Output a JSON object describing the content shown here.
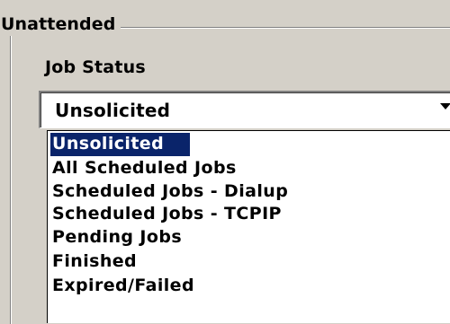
{
  "group": {
    "title": "Unattended"
  },
  "job_status": {
    "label": "Job Status",
    "selected_value": "Unsolicited",
    "options": [
      "Unsolicited",
      "All Scheduled Jobs",
      "Scheduled Jobs - Dialup",
      "Scheduled Jobs - TCPIP",
      "Pending Jobs",
      "Finished",
      "Expired/Failed"
    ],
    "highlighted_option": "Unsolicited",
    "arrow_icon": "chevron-down-icon"
  },
  "colors": {
    "dialog_background": "#d4d0c8",
    "highlight_background": "#0a246a",
    "highlight_text": "#ffffff"
  }
}
